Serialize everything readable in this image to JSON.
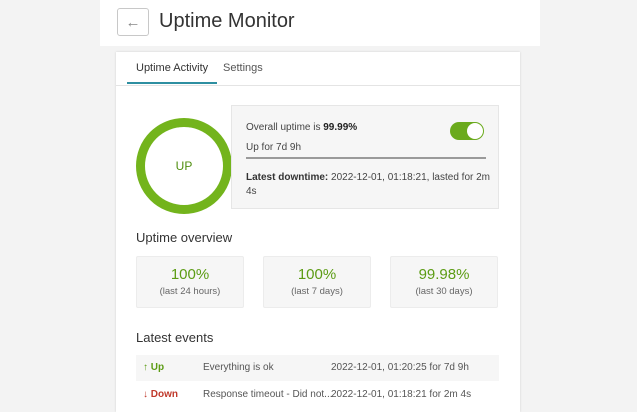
{
  "header": {
    "back_glyph": "←",
    "title": "Uptime Monitor"
  },
  "tabs": [
    {
      "label": "Uptime Activity",
      "active": true
    },
    {
      "label": "Settings",
      "active": false
    }
  ],
  "status": {
    "ring_label": "UP",
    "overall_prefix": "Overall uptime is ",
    "overall_value": "99.99%",
    "toggle_on": true,
    "up_for": "Up for 7d 9h",
    "progress_fraction": 1.0,
    "latest_downtime_label": "Latest downtime:",
    "latest_downtime_value": " 2022-12-01, 01:18:21, lasted for 2m 4s"
  },
  "overview": {
    "title": "Uptime overview",
    "stats": [
      {
        "value": "100%",
        "label": "(last 24 hours)"
      },
      {
        "value": "100%",
        "label": "(last 7 days)"
      },
      {
        "value": "99.98%",
        "label": "(last 30 days)"
      }
    ]
  },
  "events": {
    "title": "Latest events",
    "rows": [
      {
        "type": "↑ Up",
        "message": "Everything is ok",
        "time": "2022-12-01, 01:20:25 for 7d 9h"
      },
      {
        "type": "↓ Down",
        "message": "Response timeout - Did not...",
        "time": "2022-12-01, 01:18:21 for 2m 4s"
      }
    ]
  },
  "colors": {
    "accent_green": "#73b41c",
    "tab_underline": "#2e8fa1",
    "down_red": "#c0392b"
  }
}
